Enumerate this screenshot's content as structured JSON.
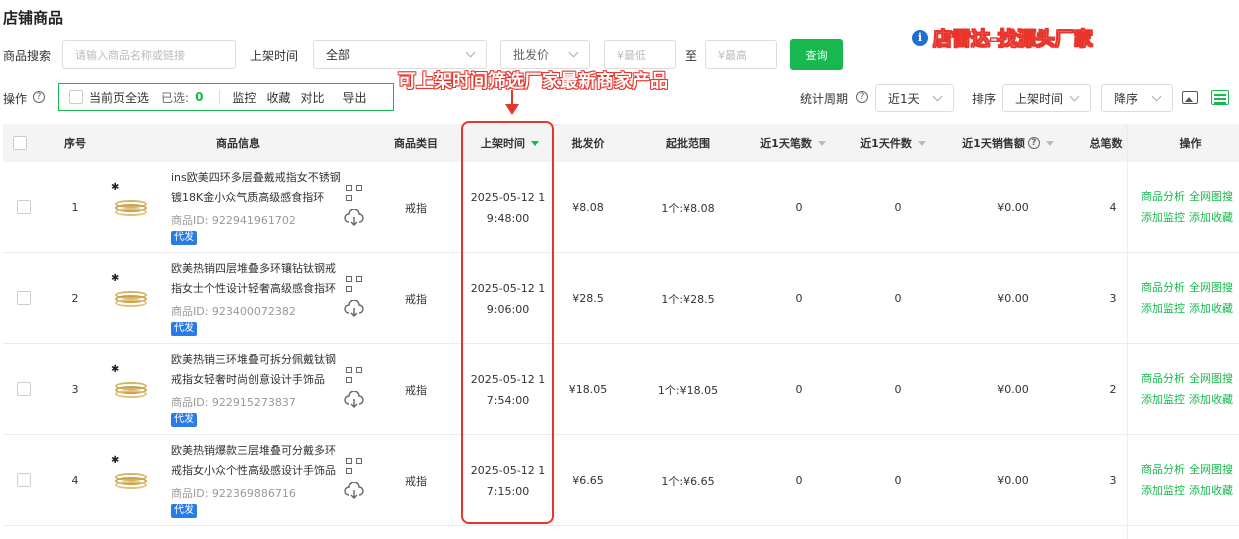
{
  "page_title": "店铺商品",
  "brand_banner": "店雷达-找源头厂家",
  "filters": {
    "search_label": "商品搜索",
    "search_placeholder": "请输入商品名称或链接",
    "time_label": "上架时间",
    "time_value": "全部",
    "price_select": "批发价",
    "min_placeholder": "¥最低",
    "to_label": "至",
    "max_placeholder": "¥最高",
    "query_button": "查询"
  },
  "annotation": "可上架时间筛选厂家最新商家产品",
  "ops": {
    "label": "操作",
    "select_page": "当前页全选",
    "selected_label": "已选:",
    "selected_count": "0",
    "monitor": "监控",
    "favorite": "收藏",
    "compare": "对比",
    "export": "导出"
  },
  "right_controls": {
    "period_label": "统计周期",
    "period_value": "近1天",
    "sort_label": "排序",
    "sort_value": "上架时间",
    "order_value": "降序"
  },
  "columns": [
    "序号",
    "商品信息",
    "商品类目",
    "上架时间",
    "批发价",
    "起批范围",
    "近1天笔数",
    "近1天件数",
    "近1天销售额",
    "总笔数",
    "操作"
  ],
  "rows": [
    {
      "index": "1",
      "name": "ins欧美四环多层叠戴戒指女不锈钢镀18K金小众气质高级感食指环",
      "id": "商品ID:  922941961702",
      "tag": "代发",
      "category": "戒指",
      "time": "2025-05-12 19:48:00",
      "price": "¥8.08",
      "range": "1个:¥8.08",
      "orders": "0",
      "pieces": "0",
      "sales": "¥0.00",
      "total": "4"
    },
    {
      "index": "2",
      "name": "欧美热销四层堆叠多环镶钻钛钢戒指女士个性设计轻奢高级感食指环",
      "id": "商品ID:  923400072382",
      "tag": "代发",
      "category": "戒指",
      "time": "2025-05-12 19:06:00",
      "price": "¥28.5",
      "range": "1个:¥28.5",
      "orders": "0",
      "pieces": "0",
      "sales": "¥0.00",
      "total": "3"
    },
    {
      "index": "3",
      "name": "欧美热销三环堆叠可拆分佩戴钛钢戒指女轻奢时尚创意设计手饰品",
      "id": "商品ID:  922915273837",
      "tag": "代发",
      "category": "戒指",
      "time": "2025-05-12 17:54:00",
      "price": "¥18.05",
      "range": "1个:¥18.05",
      "orders": "0",
      "pieces": "0",
      "sales": "¥0.00",
      "total": "2"
    },
    {
      "index": "4",
      "name": "欧美热销爆款三层堆叠可分戴多环戒指女小众个性高级感设计手饰品",
      "id": "商品ID:  922369886716",
      "tag": "代发",
      "category": "戒指",
      "time": "2025-05-12 17:15:00",
      "price": "¥6.65",
      "range": "1个:¥6.65",
      "orders": "0",
      "pieces": "0",
      "sales": "¥0.00",
      "total": "3"
    }
  ],
  "row_actions": {
    "analyze": "商品分析",
    "search_web": "全网图搜",
    "add_monitor": "添加监控",
    "add_favorite": "添加收藏"
  },
  "colors": {
    "accent": "#17b84f",
    "annotation": "#e8342b",
    "tag": "#2a7be6"
  }
}
